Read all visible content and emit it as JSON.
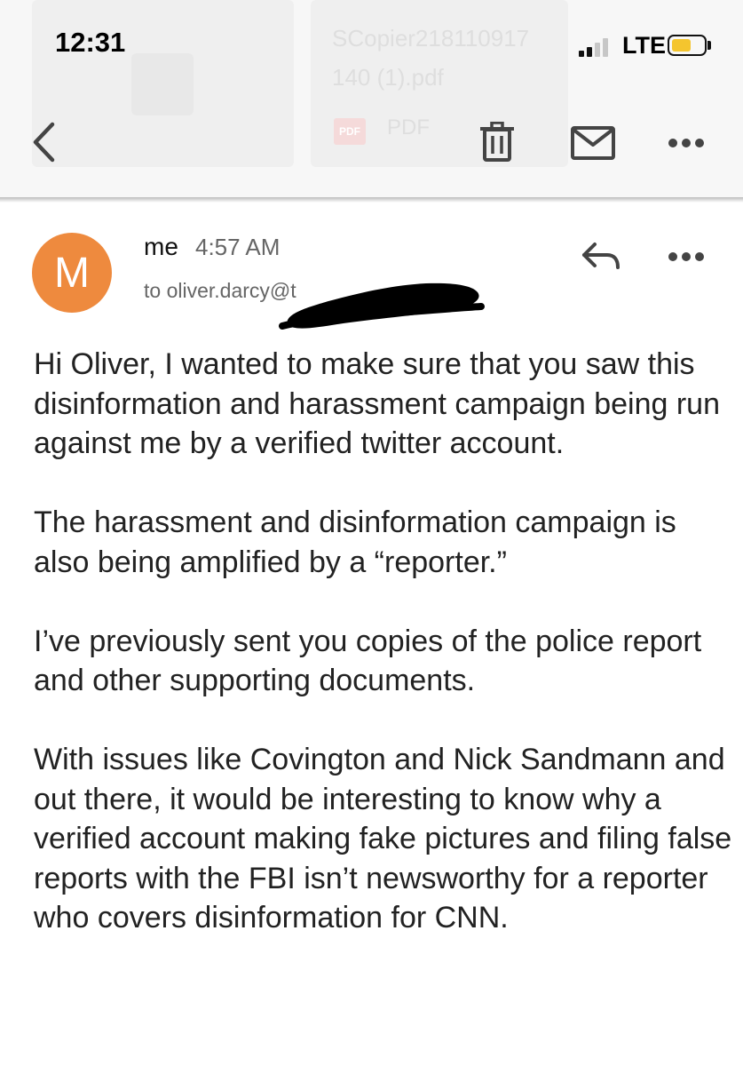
{
  "status_bar": {
    "time": "12:31",
    "network": "LTE",
    "battery_color": "#f4c52e"
  },
  "background_attachment": {
    "filename_line1": "SCopier218110917",
    "filename_line2": "140 (1).pdf",
    "file_type_badge": "PDF",
    "file_type_label": "PDF"
  },
  "toolbar": {
    "icons": [
      "back-icon",
      "trash-icon",
      "mail-icon",
      "more-icon"
    ]
  },
  "email": {
    "avatar_letter": "M",
    "avatar_color": "#ee8a3e",
    "sender": "me",
    "time": "4:57 AM",
    "recipient": "to oliver.darcy@t",
    "paragraphs": [
      "Hi Oliver, I wanted to make sure that you saw this disinformation and harassment campaign being run against me by a verified twitter account.",
      "The harassment and disinformation campaign is also being amplified by a “reporter.”",
      "I’ve previously sent you copies of the police report and other supporting documents.",
      "With issues like Covington and Nick Sandmann and out there, it would be interesting to know why a verified account making fake pictures and filing false reports with the FBI isn’t newsworthy for a reporter who covers disinformation for CNN."
    ]
  }
}
